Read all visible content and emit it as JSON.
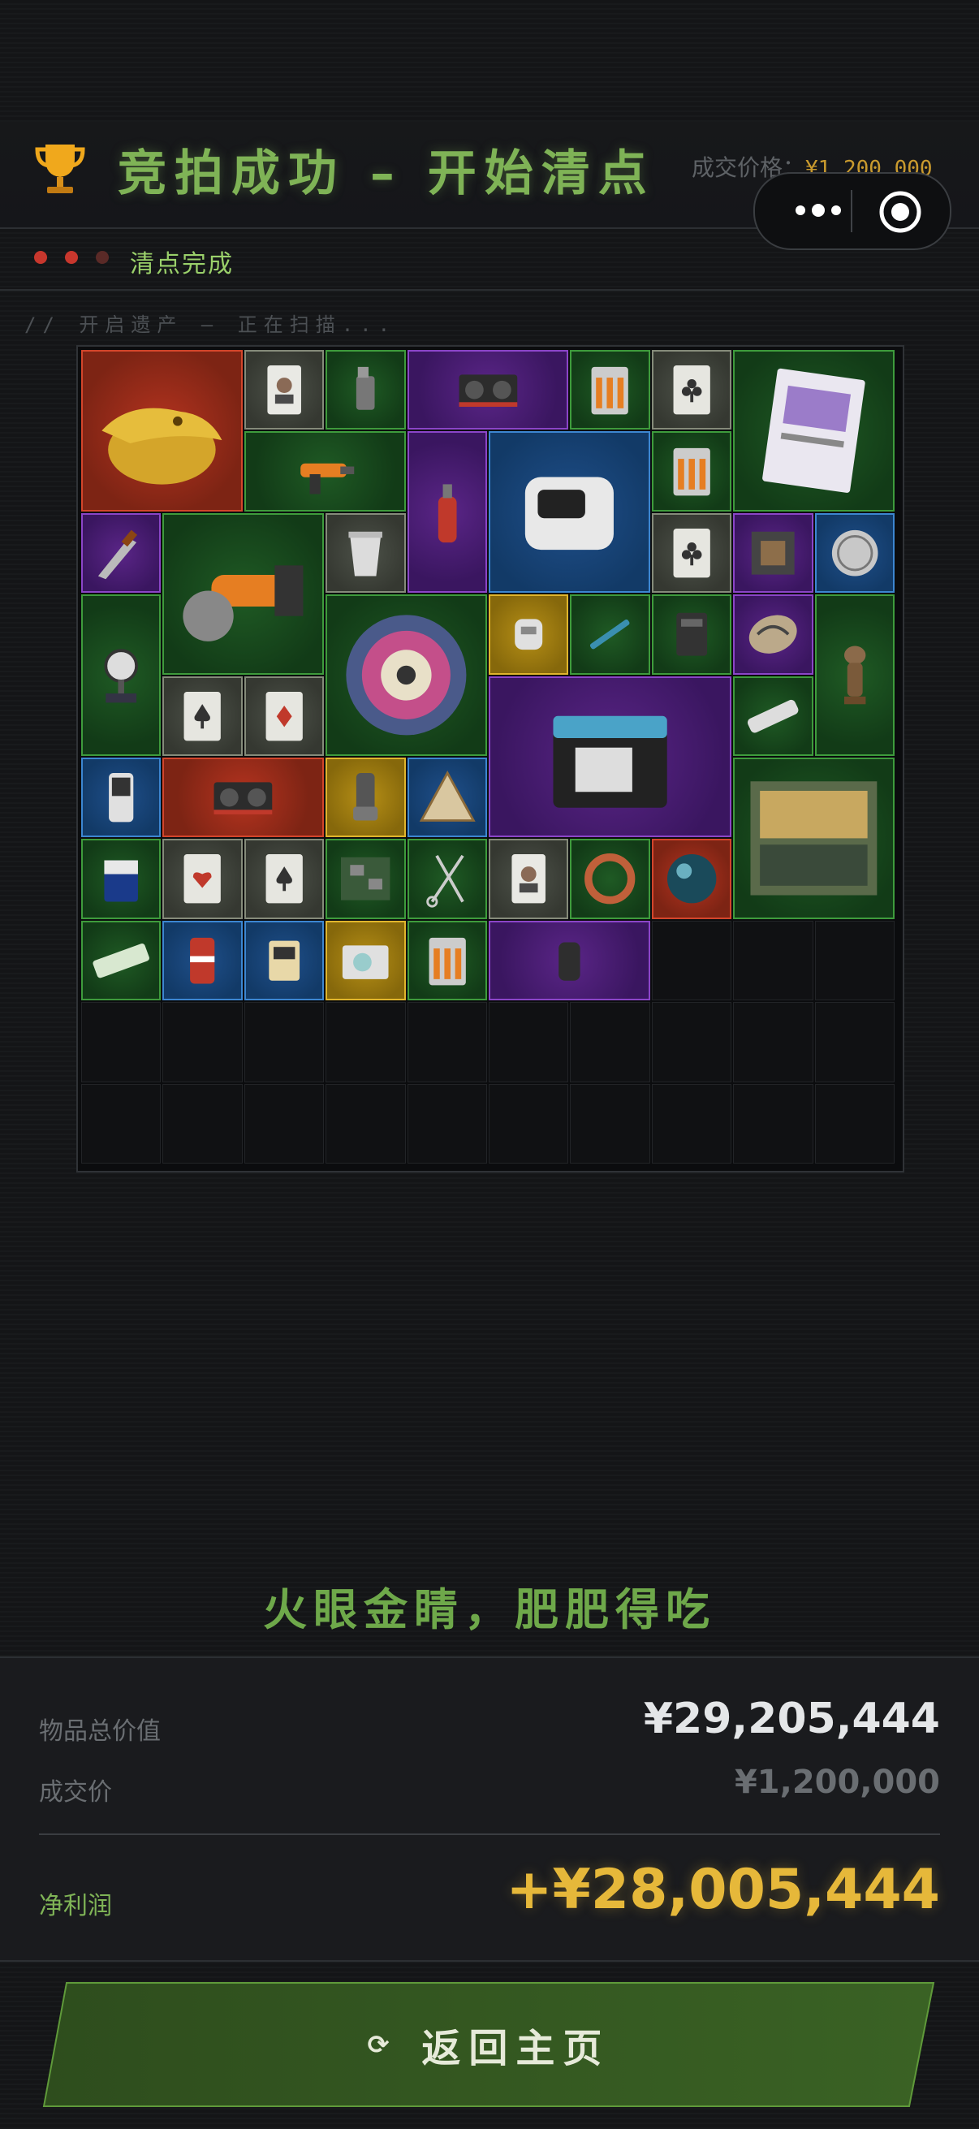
{
  "header": {
    "title": "竞拍成功 – 开始清点",
    "deal_price_label": "成交价格：",
    "deal_price_value": "¥1,200,000"
  },
  "status": {
    "text": "清点完成",
    "dot_colors": [
      "#c8372d",
      "#c8372d",
      "#5a2a27"
    ]
  },
  "scan_text": "// 开启遗产 – 正在扫描...",
  "grid": {
    "columns": 10,
    "rows": 10,
    "items": [
      {
        "icon": "golden-crocodile-statue",
        "quality": "red"
      },
      {
        "icon": "portrait-playing-card",
        "quality": "gray"
      },
      {
        "icon": "lighter",
        "quality": "green"
      },
      {
        "icon": "graphics-card",
        "quality": "purple"
      },
      {
        "icon": "battery-pack",
        "quality": "green"
      },
      {
        "icon": "club-card",
        "quality": "gray"
      },
      {
        "icon": "magazine",
        "quality": "green"
      },
      {
        "icon": "drill",
        "quality": "green"
      },
      {
        "icon": "blowtorch",
        "quality": "purple"
      },
      {
        "icon": "smart-speaker",
        "quality": "blue"
      },
      {
        "icon": "battery-pack",
        "quality": "green"
      },
      {
        "icon": "knife",
        "quality": "purple"
      },
      {
        "icon": "angle-grinder",
        "quality": "green"
      },
      {
        "icon": "yogurt-cup",
        "quality": "gray"
      },
      {
        "icon": "club-card",
        "quality": "gray"
      },
      {
        "icon": "circuit-chip",
        "quality": "purple"
      },
      {
        "icon": "silver-coin",
        "quality": "blue"
      },
      {
        "icon": "pressure-gauge",
        "quality": "green"
      },
      {
        "icon": "ornate-plate",
        "quality": "green"
      },
      {
        "icon": "small-sensor",
        "quality": "gold"
      },
      {
        "icon": "test-pen",
        "quality": "green"
      },
      {
        "icon": "phone-battery",
        "quality": "green"
      },
      {
        "icon": "decorative-egg",
        "quality": "purple"
      },
      {
        "icon": "wooden-idol",
        "quality": "green"
      },
      {
        "icon": "spade-card",
        "quality": "gray"
      },
      {
        "icon": "diamond-card",
        "quality": "gray"
      },
      {
        "icon": "car-battery",
        "quality": "purple"
      },
      {
        "icon": "power-strip",
        "quality": "green"
      },
      {
        "icon": "music-player",
        "quality": "blue"
      },
      {
        "icon": "graphics-card",
        "quality": "red"
      },
      {
        "icon": "inhaler",
        "quality": "gold"
      },
      {
        "icon": "pyramid-token",
        "quality": "blue"
      },
      {
        "icon": "painting",
        "quality": "green"
      },
      {
        "icon": "9v-battery",
        "quality": "green"
      },
      {
        "icon": "heart-card",
        "quality": "gray"
      },
      {
        "icon": "spade-card",
        "quality": "gray"
      },
      {
        "icon": "circuit-board",
        "quality": "green"
      },
      {
        "icon": "scissors-clamp",
        "quality": "green"
      },
      {
        "icon": "portrait-playing-card",
        "quality": "gray"
      },
      {
        "icon": "coiled-wire",
        "quality": "green"
      },
      {
        "icon": "glass-orb",
        "quality": "red"
      },
      {
        "icon": "snack-bar",
        "quality": "green"
      },
      {
        "icon": "soda-can",
        "quality": "blue"
      },
      {
        "icon": "memory-card",
        "quality": "blue"
      },
      {
        "icon": "optical-disc",
        "quality": "gold"
      },
      {
        "icon": "battery-pack",
        "quality": "green"
      },
      {
        "icon": "dark-stone",
        "quality": "purple"
      }
    ]
  },
  "slogan": "火眼金睛，肥肥得吃",
  "summary": {
    "total_label": "物品总价值",
    "total_value": "¥29,205,444",
    "deal_label": "成交价",
    "deal_value": "¥1,200,000",
    "profit_label": "净利润",
    "profit_value": "+¥28,005,444"
  },
  "home_button": {
    "icon": "refresh-icon",
    "label": "返回主页"
  },
  "colors": {
    "accent_green": "#7fb356",
    "gold": "#e6b83a",
    "background": "#141517"
  }
}
